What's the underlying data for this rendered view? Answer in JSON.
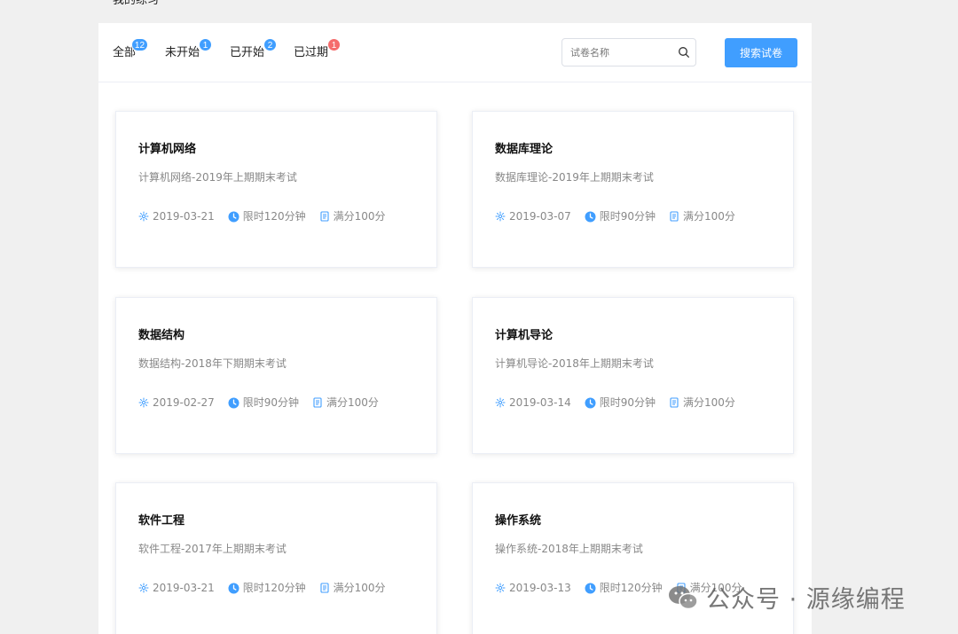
{
  "page": {
    "heading": "我的练习"
  },
  "tabs": [
    {
      "label": "全部",
      "count": "12",
      "badge_color": "#409eff"
    },
    {
      "label": "未开始",
      "count": "1",
      "badge_color": "#409eff"
    },
    {
      "label": "已开始",
      "count": "2",
      "badge_color": "#409eff"
    },
    {
      "label": "已过期",
      "count": "1",
      "badge_color": "#f56c6c"
    }
  ],
  "search": {
    "placeholder": "试卷名称",
    "value": "",
    "button_label": "搜索试卷"
  },
  "cards": [
    {
      "title": "计算机网络",
      "desc": "计算机网络-2019年上期期末考试",
      "date": "2019-03-21",
      "time_limit": "限时120分钟",
      "full_score": "满分100分"
    },
    {
      "title": "数据库理论",
      "desc": "数据库理论-2019年上期期末考试",
      "date": "2019-03-07",
      "time_limit": "限时90分钟",
      "full_score": "满分100分"
    },
    {
      "title": "数据结构",
      "desc": "数据结构-2018年下期期末考试",
      "date": "2019-02-27",
      "time_limit": "限时90分钟",
      "full_score": "满分100分"
    },
    {
      "title": "计算机导论",
      "desc": "计算机导论-2018年上期期末考试",
      "date": "2019-03-14",
      "time_limit": "限时90分钟",
      "full_score": "满分100分"
    },
    {
      "title": "软件工程",
      "desc": "软件工程-2017年上期期末考试",
      "date": "2019-03-21",
      "time_limit": "限时120分钟",
      "full_score": "满分100分"
    },
    {
      "title": "操作系统",
      "desc": "操作系统-2018年上期期末考试",
      "date": "2019-03-13",
      "time_limit": "限时120分钟",
      "full_score": "满分100分"
    }
  ],
  "watermark": {
    "text": "公众号 · 源缘编程"
  },
  "colors": {
    "accent": "#409eff",
    "danger": "#f56c6c",
    "muted_text": "#888888"
  },
  "icons": {
    "date": "sun-icon",
    "time": "clock-icon",
    "score": "document-icon",
    "search": "search-icon",
    "watermark": "wechat-icon"
  }
}
